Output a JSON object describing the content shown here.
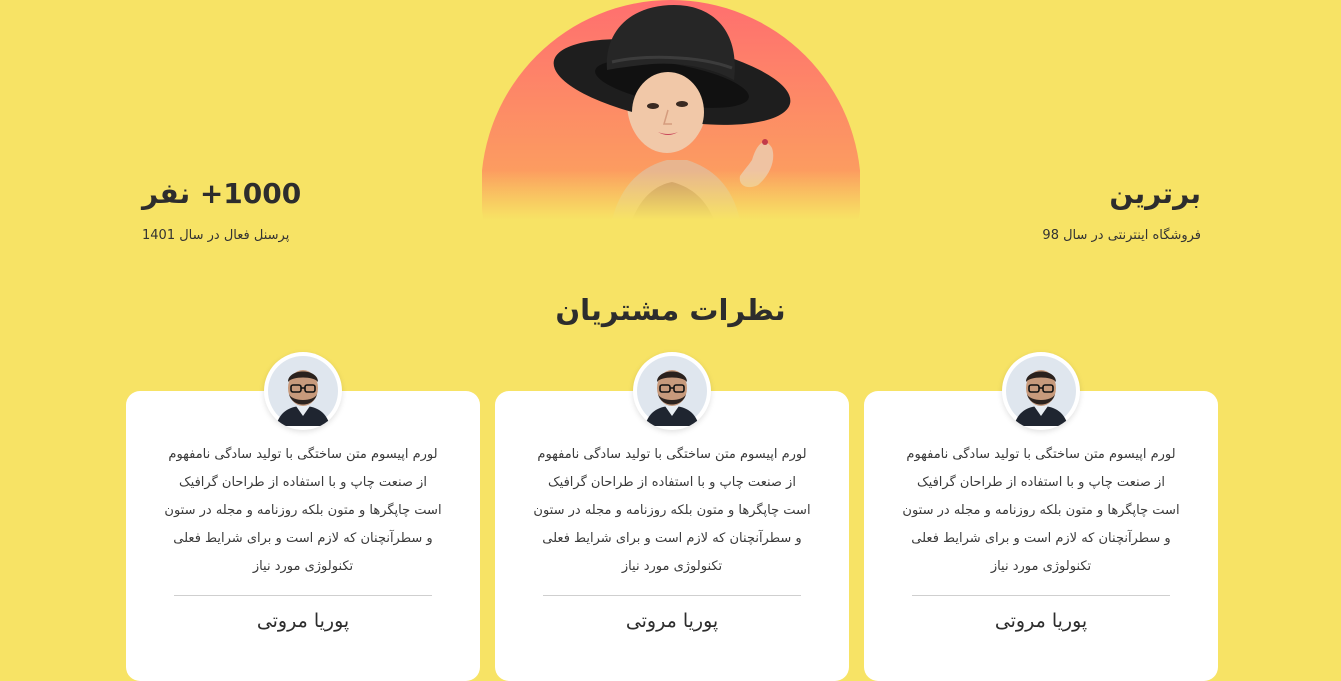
{
  "hero": {
    "right_stat": {
      "title": "برترین",
      "subtitle": "فروشگاه اینترنتی در سال 98"
    },
    "left_stat": {
      "title": "1000+ نفر",
      "subtitle": "پرسنل فعال در سال 1401"
    },
    "image": "woman-in-black-hat-photo"
  },
  "testimonials": {
    "title": "نظرات مشتریان",
    "cards": [
      {
        "avatar": "man-with-glasses-photo",
        "text": "لورم اپیسوم متن ساختگی با تولید سادگی نامفهوم از صنعت چاپ و با استفاده از طراحان گرافیک است چاپگرها و متون بلکه روزنامه و مجله در ستون و سطرآنچنان که لازم است و برای شرایط فعلی تکنولوژی مورد نیاز",
        "author": "پوریا مروتی"
      },
      {
        "avatar": "man-with-glasses-photo",
        "text": "لورم اپیسوم متن ساختگی با تولید سادگی نامفهوم از صنعت چاپ و با استفاده از طراحان گرافیک است چاپگرها و متون بلکه روزنامه و مجله در ستون و سطرآنچنان که لازم است و برای شرایط فعلی تکنولوژی مورد نیاز",
        "author": "پوریا مروتی"
      },
      {
        "avatar": "man-with-glasses-photo",
        "text": "لورم اپیسوم متن ساختگی با تولید سادگی نامفهوم از صنعت چاپ و با استفاده از طراحان گرافیک است چاپگرها و متون بلکه روزنامه و مجله در ستون و سطرآنچنان که لازم است و برای شرایط فعلی تکنولوژی مورد نیاز",
        "author": "پوریا مروتی"
      }
    ]
  },
  "colors": {
    "background": "#f7e365",
    "card": "#ffffff",
    "text": "#2d2d2d",
    "hero_gradient_top": "#ff7a6b",
    "hero_gradient_bottom": "#f7e365"
  }
}
